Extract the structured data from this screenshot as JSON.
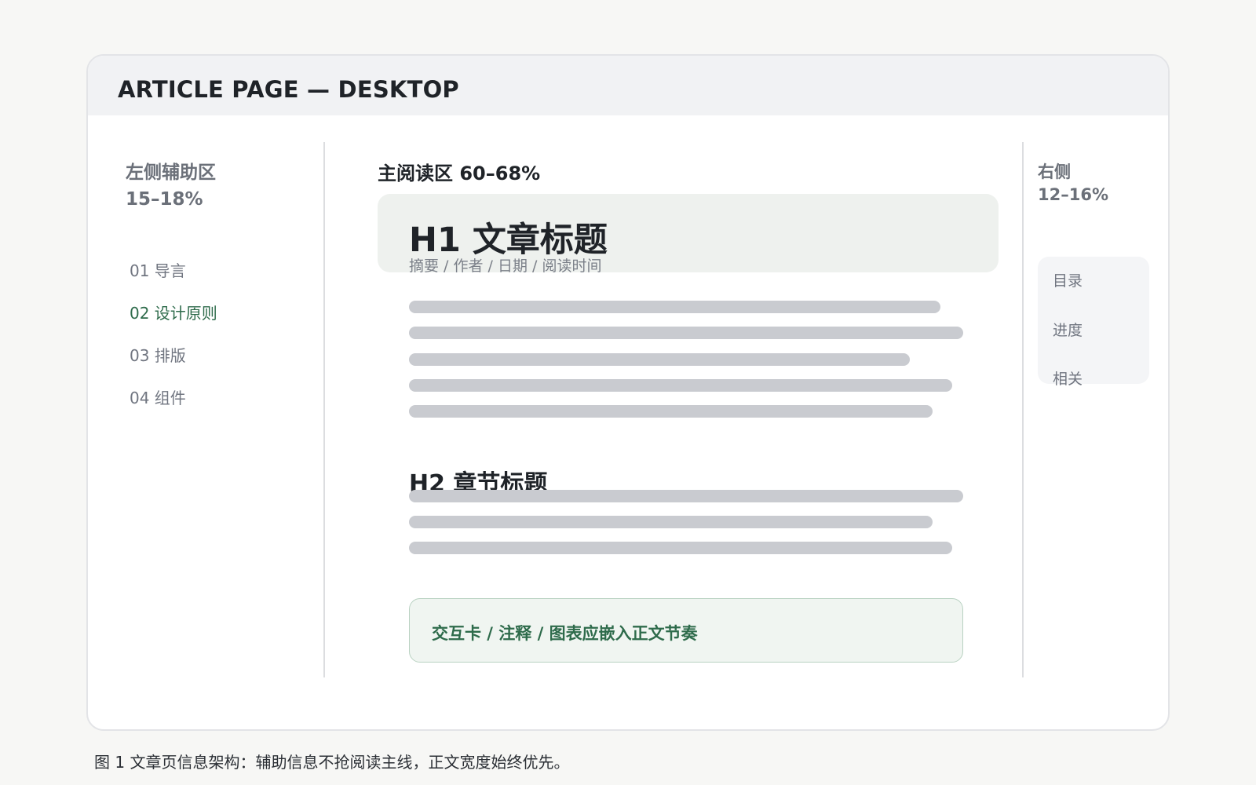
{
  "frame": {
    "title": "ARTICLE PAGE — DESKTOP"
  },
  "left": {
    "label_line1": "左侧辅助区",
    "label_line2": "15–18%",
    "nav": [
      {
        "label": "01 导言"
      },
      {
        "label": "02 设计原则",
        "active": true
      },
      {
        "label": "03 排版"
      },
      {
        "label": "04 组件"
      }
    ]
  },
  "main": {
    "label": "主阅读区  60–68%",
    "h1": "H1 文章标题",
    "h1_meta": "摘要 / 作者 / 日期 / 阅读时间",
    "h2": "H2 章节标题",
    "callout": "交互卡 / 注释 / 图表应嵌入正文节奏"
  },
  "right": {
    "label_line1": "右侧",
    "label_line2": "12–16%",
    "items": [
      {
        "label": "目录"
      },
      {
        "label": "进度"
      },
      {
        "label": "相关"
      }
    ]
  },
  "caption": "图 1  文章页信息架构：辅助信息不抢阅读主线，正文宽度始终优先。",
  "colors": {
    "accent": "#2e6b4b",
    "placeholder_line": "#c9cbd0",
    "hero_bg": "#eef1ee",
    "callout_bg": "#f0f5f1"
  }
}
